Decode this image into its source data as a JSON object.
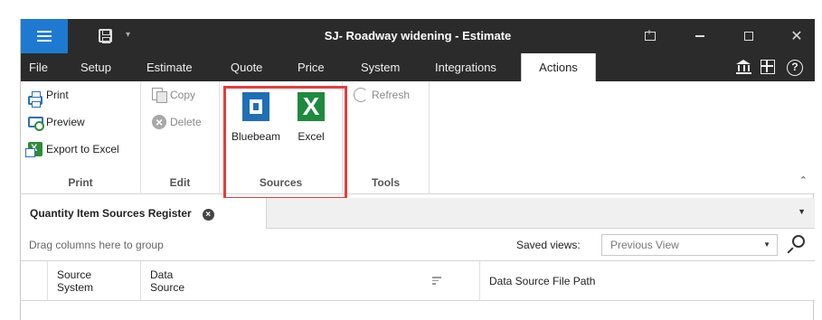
{
  "window": {
    "title": "SJ- Roadway widening - Estimate",
    "close_glyph": "✕"
  },
  "menu": {
    "items": [
      "File",
      "Setup",
      "Estimate",
      "Quote",
      "Price",
      "System",
      "Integrations",
      "Actions"
    ],
    "active": "Actions",
    "right_icons": [
      "bank-icon",
      "grid-layout-icon",
      "help-icon"
    ]
  },
  "ribbon": {
    "print_group": {
      "label": "Print",
      "buttons": [
        "Print",
        "Preview",
        "Export to Excel"
      ]
    },
    "edit_group": {
      "label": "Edit",
      "buttons": [
        "Copy",
        "Delete"
      ]
    },
    "sources_group": {
      "label": "Sources",
      "buttons": [
        "Bluebeam",
        "Excel"
      ]
    },
    "tools_group": {
      "label": "Tools",
      "buttons": [
        "Refresh"
      ]
    },
    "highlight_color": "#e63c3c"
  },
  "panel": {
    "tab_title": "Quantity Item Sources Register",
    "group_hint": "Drag columns here to group",
    "saved_views_label": "Saved views:",
    "saved_views_value": "Previous View",
    "columns": [
      [
        "Source",
        "System"
      ],
      [
        "Data",
        "Source"
      ],
      "Data Source File Path"
    ]
  },
  "colors": {
    "titlebar": "#2b2b2b",
    "menu_button": "#1e7ad1",
    "bluebeam": "#1f6fb5",
    "excel": "#1e8a3f"
  }
}
